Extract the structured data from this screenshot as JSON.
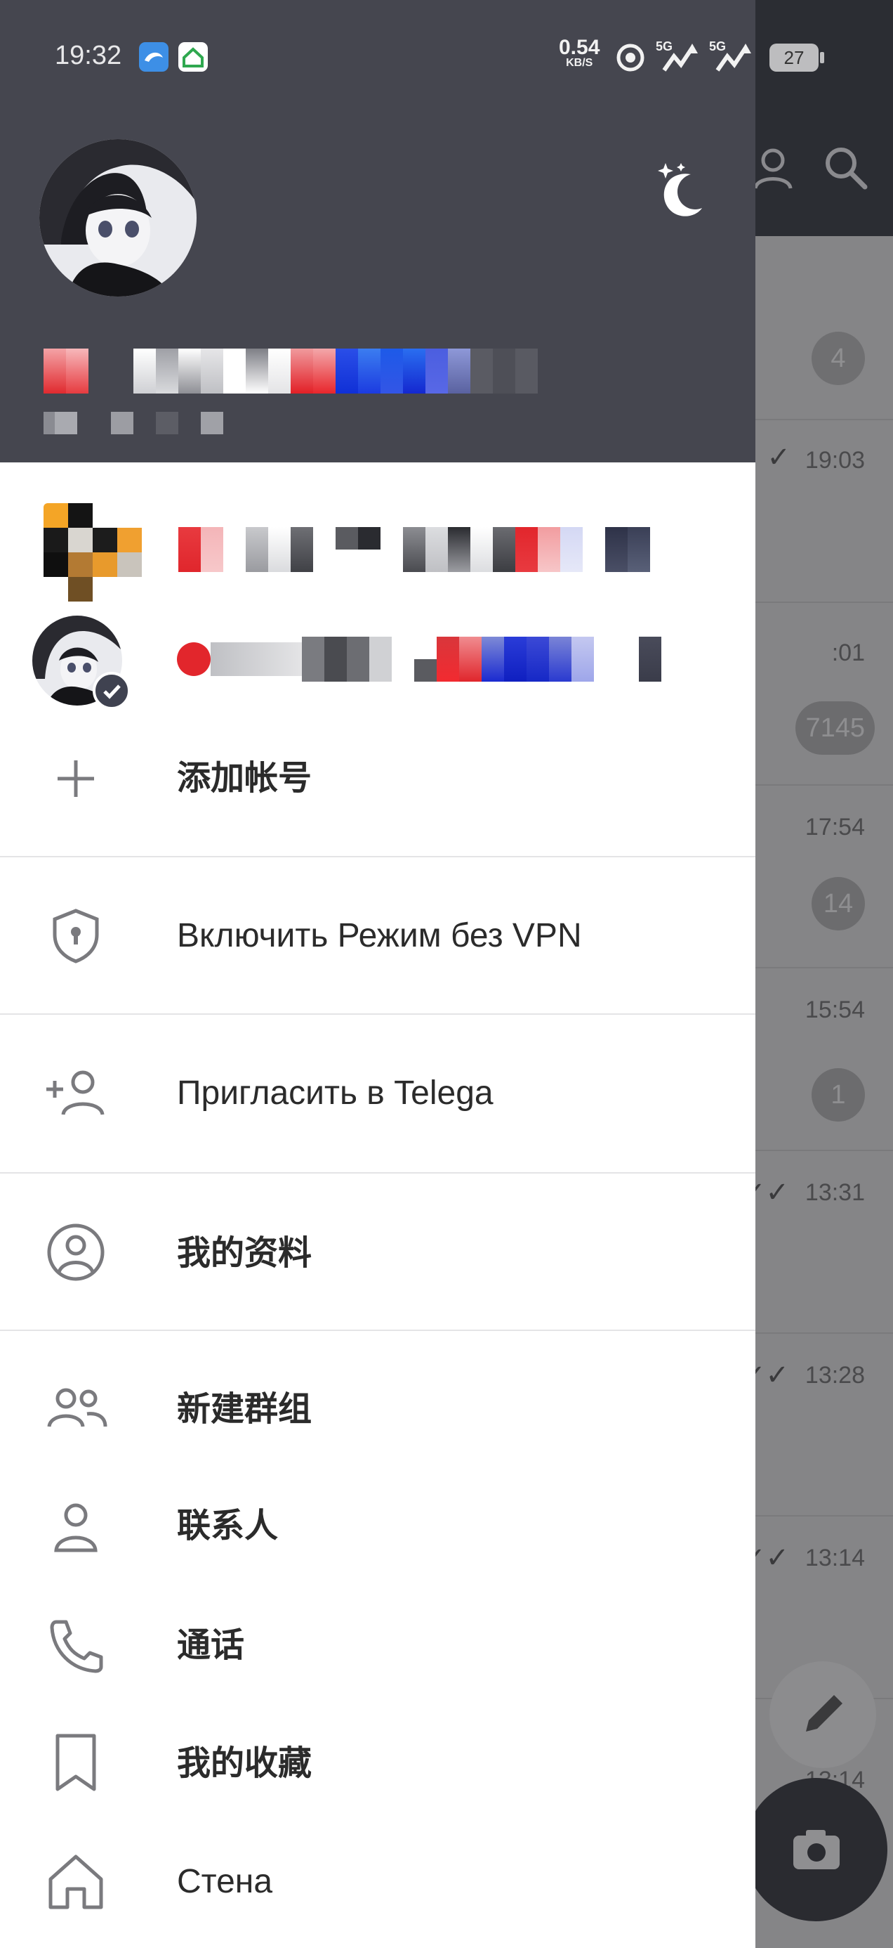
{
  "status_bar": {
    "time": "19:32",
    "net_speed": "0.54",
    "net_speed_unit": "KB/S",
    "signal_1_label": "5G",
    "signal_2_label": "5G",
    "battery": "27"
  },
  "background_chats": {
    "badge_1": "4",
    "rows": [
      {
        "time": "19:03",
        "badge": ""
      },
      {
        "time": "",
        "badge": "7145"
      },
      {
        "time": "17:54",
        "badge": "14"
      },
      {
        "time": "15:54",
        "badge": "1"
      },
      {
        "time": "13:31",
        "badge": ""
      },
      {
        "time": "13:28",
        "badge": ""
      },
      {
        "time": "13:14",
        "badge": ""
      },
      {
        "time": "13:14",
        "badge": ""
      }
    ]
  },
  "accounts": {
    "add_account_label": "添加帐号"
  },
  "menu": {
    "vpn_label": "Включить Режим без VPN",
    "invite_label": "Пригласить в Telega",
    "profile_label": "我的资料",
    "new_group_label": "新建群组",
    "contacts_label": "联系人",
    "calls_label": "通话",
    "saved_label": "我的收藏",
    "wall_label": "Стена"
  },
  "colors": {
    "header_bg": "#45464f",
    "drawer_bg": "#ffffff",
    "icon_gray": "#7a7a7e",
    "label_text": "#2b2b2b"
  }
}
